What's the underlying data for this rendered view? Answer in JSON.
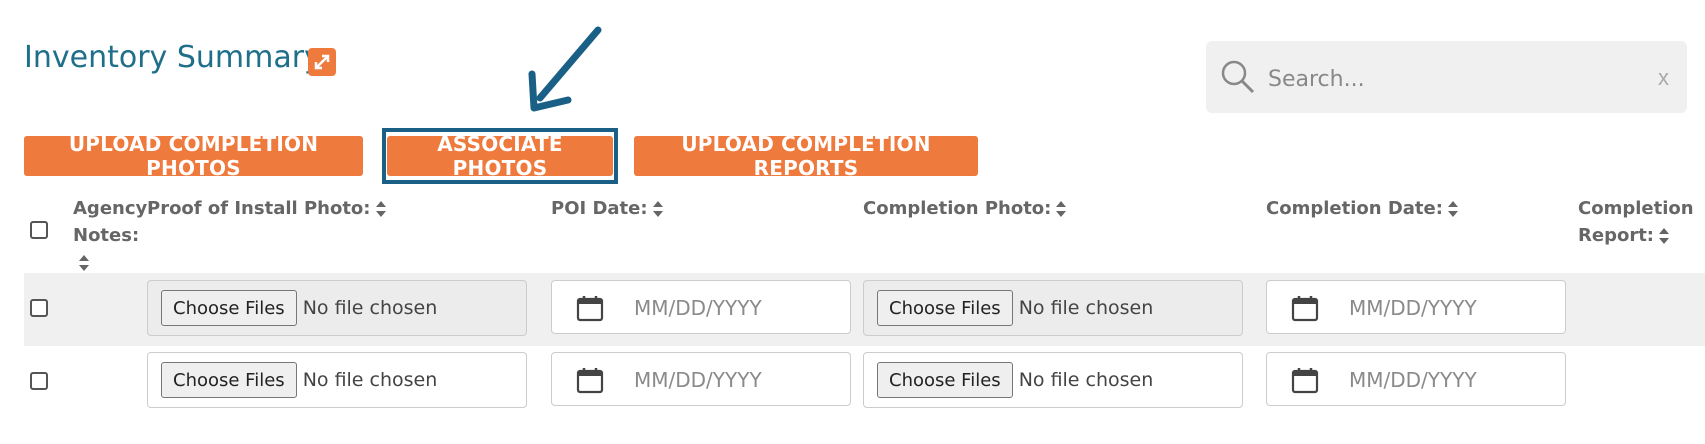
{
  "header": {
    "title": "Inventory Summary"
  },
  "search": {
    "placeholder": "Search...",
    "clear": "x"
  },
  "actions": {
    "upload_photos": "UPLOAD COMPLETION PHOTOS",
    "associate_photos": "ASSOCIATE PHOTOS",
    "upload_reports": "UPLOAD COMPLETION REPORTS"
  },
  "columns": {
    "agency_notes_1": "Agency",
    "agency_notes_2": "Notes:",
    "proof_photo": "Proof of Install Photo:",
    "poi_date": "POI Date:",
    "completion_photo": "Completion Photo:",
    "completion_date": "Completion Date:",
    "completion_report_1": "Completion",
    "completion_report_2": "Report:"
  },
  "rows": [
    {
      "choose_label": "Choose Files",
      "no_file": "No file chosen",
      "date_placeholder": "MM/DD/YYYY"
    },
    {
      "choose_label": "Choose Files",
      "no_file": "No file chosen",
      "date_placeholder": "MM/DD/YYYY"
    }
  ],
  "colors": {
    "accent": "#ef7a3d",
    "title": "#1f6f8b",
    "highlight": "#1a5f85"
  },
  "icons": [
    "expand-icon",
    "search-icon",
    "clear-icon",
    "sort-icon",
    "calendar-icon",
    "arrow-annotation"
  ]
}
